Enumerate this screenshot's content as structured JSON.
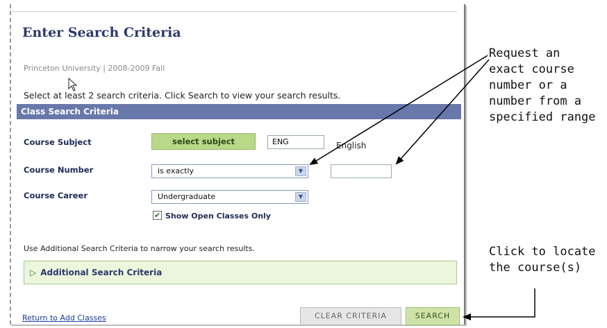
{
  "page": {
    "title": "Enter Search Criteria",
    "context": "Princeton University | 2008-2009 Fall",
    "instruction": "Select at least 2 search criteria. Click Search to view your search results."
  },
  "section": {
    "header": "Class Search Criteria"
  },
  "form": {
    "course_subject": {
      "label": "Course Subject",
      "button_label": "select subject",
      "value": "ENG",
      "description": "English"
    },
    "course_number": {
      "label": "Course Number",
      "operator": "is exactly",
      "value": ""
    },
    "course_career": {
      "label": "Course Career",
      "value": "Undergraduate"
    },
    "open_only": {
      "label": "Show Open Classes Only",
      "checked": true
    }
  },
  "additional": {
    "hint": "Use Additional Search Criteria to narrow your search results.",
    "label": "Additional Search Criteria"
  },
  "footer": {
    "return_link": "Return to Add Classes",
    "clear_label": "CLEAR CRITERIA",
    "search_label": "SEARCH"
  },
  "annotations": {
    "course_number_note": [
      "Request an",
      "exact course",
      "number or a",
      "number from a",
      "specified range"
    ],
    "search_note": [
      "Click to locate",
      "the course(s)"
    ]
  },
  "colors": {
    "section_bar": "#6878aa",
    "subject_button": "#b9d888",
    "search_button": "#cfe3a8",
    "title": "#2b3a6a"
  }
}
